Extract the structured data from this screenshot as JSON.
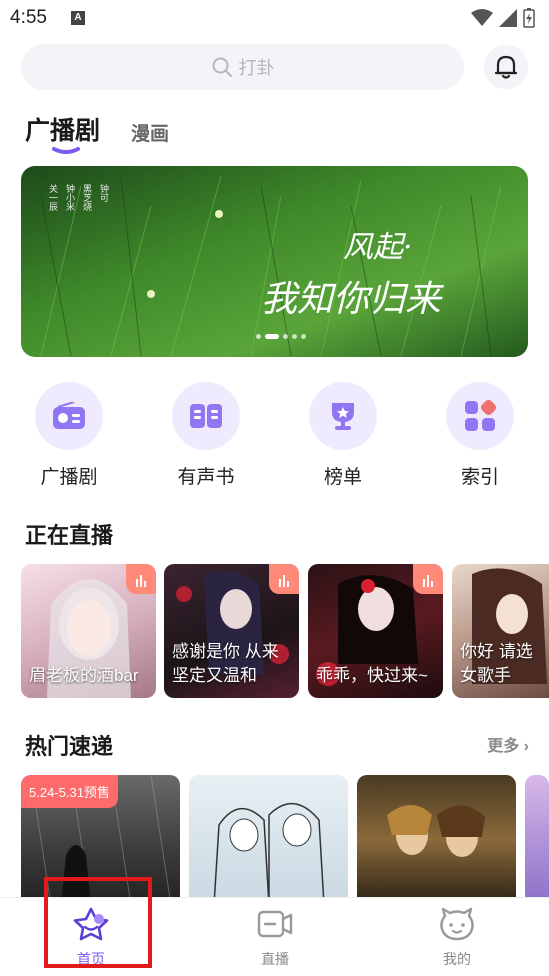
{
  "status_bar": {
    "time": "4:55",
    "app_badge": "A"
  },
  "search": {
    "placeholder": "打卦"
  },
  "top_tabs": {
    "active": "广播剧",
    "second": "漫画"
  },
  "banner": {
    "title_line1": "风起·",
    "title_line2": "我知你归来",
    "credits": [
      "关一辰",
      "钟小米",
      "黑芝烧",
      "钟可"
    ],
    "dots": 5,
    "active_dot": 1
  },
  "categories": [
    {
      "label": "广播剧",
      "icon": "radio-icon"
    },
    {
      "label": "有声书",
      "icon": "book-icon"
    },
    {
      "label": "榜单",
      "icon": "trophy-icon"
    },
    {
      "label": "索引",
      "icon": "index-icon"
    }
  ],
  "live_section": {
    "title": "正在直播",
    "cards": [
      {
        "text": "眉老板的酒bar"
      },
      {
        "text": "感谢是你 从来坚定又温和"
      },
      {
        "text": "乖乖，快过来~"
      },
      {
        "text": "你好 请选女歌手"
      }
    ]
  },
  "hot_section": {
    "title": "热门速递",
    "more": "更多",
    "cards": [
      {
        "badge": "5.24-5.31预售"
      },
      {
        "badge": ""
      },
      {
        "badge": ""
      }
    ]
  },
  "bottom_nav": [
    {
      "label": "首页",
      "icon": "home-star-icon",
      "active": true
    },
    {
      "label": "直播",
      "icon": "live-tv-icon",
      "active": false
    },
    {
      "label": "我的",
      "icon": "profile-face-icon",
      "active": false
    }
  ],
  "colors": {
    "accent": "#7c5cf0",
    "category_bg": "#efeafd",
    "highlight": "#e21a1a"
  }
}
